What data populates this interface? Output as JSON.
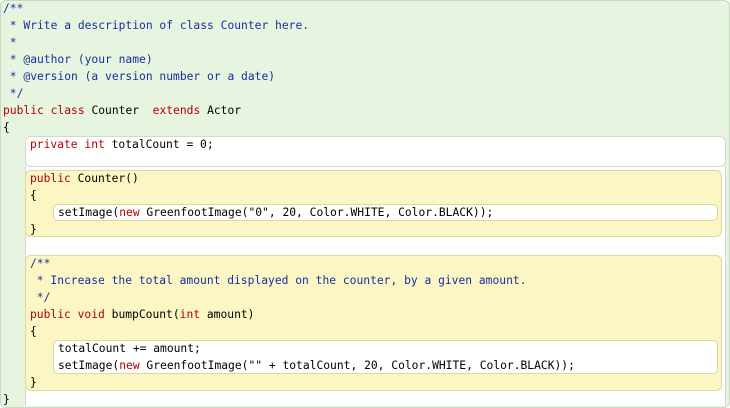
{
  "code": {
    "lines": [
      "/**",
      " * Write a description of class Counter here.",
      " *",
      " * @author (your name)",
      " * @version (a version number or a date)",
      " */",
      "public class Counter  extends Actor",
      "{",
      "private int totalCount = 0;",
      "public Counter()",
      "{",
      "setImage(new GreenfootImage(\"0\", 20, Color.WHITE, Color.BLACK));",
      "}",
      "/**",
      " * Increase the total amount displayed on the counter, by a given amount.",
      " */",
      "public void bumpCount(int amount)",
      "{",
      "totalCount += amount;",
      "setImage(new GreenfootImage(\"\" + totalCount, 20, Color.WHITE, Color.BLACK));",
      "}",
      "}"
    ]
  },
  "colors": {
    "class_scope": "#e6f4e0",
    "method_scope": "#fbf6c4",
    "body_scope": "#ffffff",
    "keyword": "#b30000",
    "comment": "#1a2fa0"
  }
}
